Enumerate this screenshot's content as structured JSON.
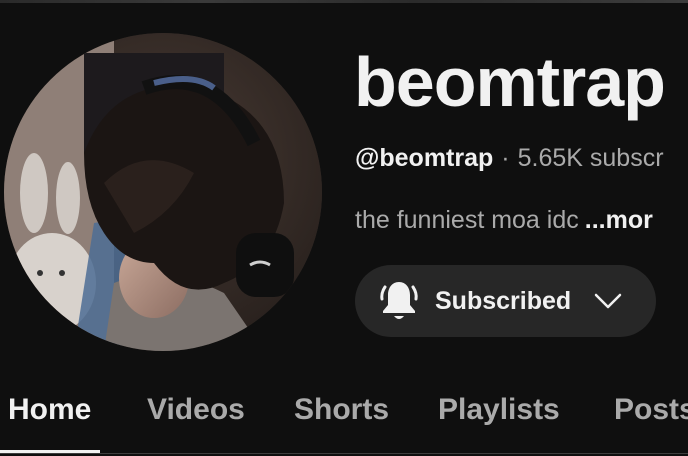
{
  "channel": {
    "name": "beomtrap",
    "handle": "@beomtrap",
    "separator": "·",
    "subscribers": "5.65K subscr",
    "description": "the funniest moa idc",
    "more_label": "...mor"
  },
  "subscribe_button": {
    "label": "Subscribed",
    "icon": "bell-icon",
    "dropdown_icon": "chevron-down-icon"
  },
  "tabs": [
    {
      "label": "Home",
      "active": true
    },
    {
      "label": "Videos",
      "active": false
    },
    {
      "label": "Shorts",
      "active": false
    },
    {
      "label": "Playlists",
      "active": false
    },
    {
      "label": "Posts",
      "active": false
    }
  ],
  "colors": {
    "background": "#0f0f0f",
    "primary_text": "#f1f1f1",
    "secondary_text": "#aaaaaa",
    "button_bg": "#272727"
  }
}
